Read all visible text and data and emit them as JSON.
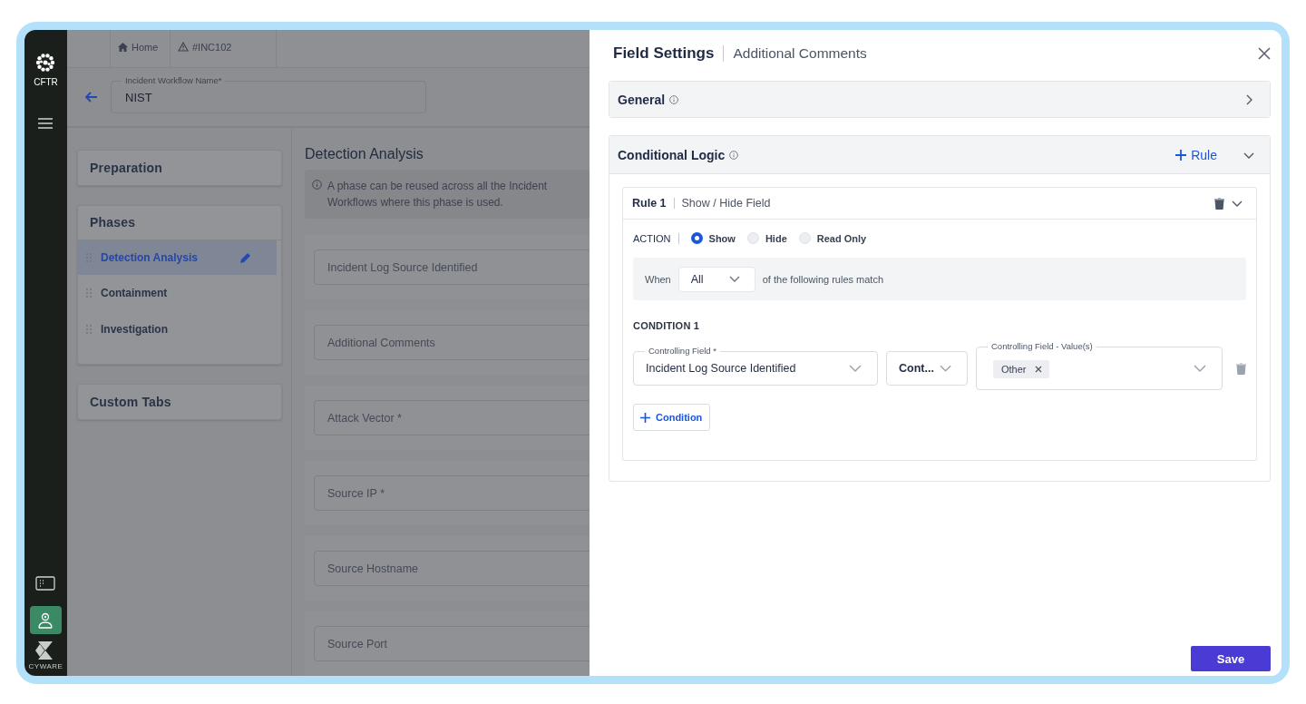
{
  "rail": {
    "logo_label": "CFTR",
    "brand_label": "CYWARE",
    "items": [
      {
        "kind": "console",
        "selected": false
      },
      {
        "kind": "user-settings",
        "selected": true
      }
    ]
  },
  "breadcrumbs": [
    {
      "kind": "home",
      "label": "Home"
    },
    {
      "kind": "incident",
      "label": "#INC102"
    }
  ],
  "workflow_name": {
    "label": "Incident Workflow Name*",
    "value": "NIST"
  },
  "sections": [
    {
      "title": "Preparation"
    },
    {
      "title": "Phases",
      "items": [
        {
          "label": "Detection Analysis",
          "selected": true
        },
        {
          "label": "Containment",
          "selected": false
        },
        {
          "label": "Investigation",
          "selected": false
        }
      ]
    },
    {
      "title": "Custom Tabs"
    }
  ],
  "phase": {
    "title": "Detection Analysis",
    "info_lines": [
      "A phase can be reused across all the Incident",
      "Workflows where this phase is used."
    ],
    "fields": [
      "Incident Log Source Identified",
      "Additional Comments",
      "Attack Vector *",
      "Source IP *",
      "Source Hostname",
      "Source Port"
    ]
  },
  "drawer": {
    "title": "Field Settings",
    "subtitle": "Additional Comments",
    "sections": [
      {
        "title": "General",
        "expanded": false
      },
      {
        "title": "Conditional Logic",
        "expanded": true,
        "add_label": "Rule"
      }
    ],
    "rule": {
      "title": "Rule 1",
      "subtitle": "Show / Hide Field",
      "expanded": true,
      "action_label": "ACTION",
      "actions": [
        {
          "label": "Show",
          "selected": true
        },
        {
          "label": "Hide",
          "selected": false
        },
        {
          "label": "Read Only",
          "selected": false
        }
      ],
      "when": {
        "prefix": "When",
        "value": "All",
        "suffix": "of the following rules match"
      },
      "conditions": [
        {
          "title": "CONDITION 1",
          "field": {
            "label": "Controlling Field *",
            "value": "Incident Log Source Identified"
          },
          "operator": "Cont...",
          "values_field": {
            "label": "Controlling Field - Value(s)",
            "chips": [
              "Other"
            ]
          }
        }
      ],
      "add_condition": "Condition"
    },
    "save": "Save"
  }
}
